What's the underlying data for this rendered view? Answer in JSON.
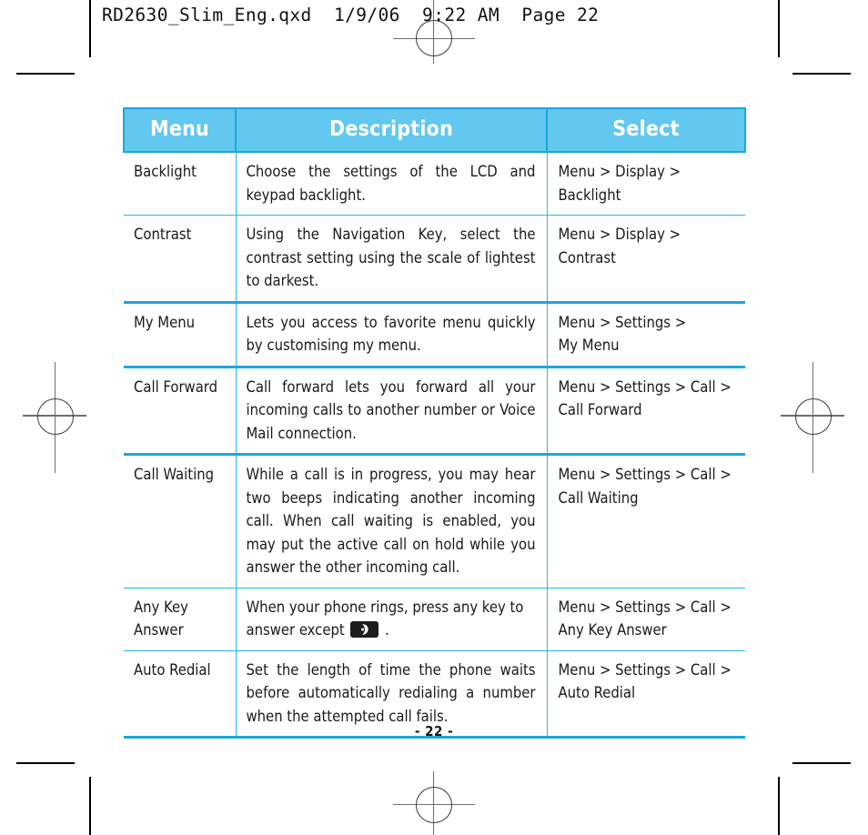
{
  "prepress": {
    "header_line": "RD2630_Slim_Eng.qxd  1/9/06  9:22 AM  Page 22"
  },
  "table": {
    "columns": [
      "Menu",
      "Description",
      "Select"
    ],
    "rows": [
      {
        "menu": "Backlight",
        "description": "Choose the settings of the LCD and keypad backlight.",
        "select": [
          "Menu > Display >",
          "Backlight"
        ]
      },
      {
        "menu": "Contrast",
        "description": "Using the Navigation Key, select the contrast setting using the scale of lightest to darkest.",
        "select": [
          "Menu > Display >",
          "Contrast"
        ]
      },
      {
        "menu": "My Menu",
        "description": "Lets you access to favorite menu quickly by customising  my menu.",
        "select": [
          "Menu > Settings >",
          "My Menu"
        ]
      },
      {
        "menu": "Call Forward",
        "description": "Call forward lets you forward all your incoming calls to another number or Voice Mail connection.",
        "select": [
          "Menu > Settings > Call >",
          "Call Forward"
        ]
      },
      {
        "menu": "Call Waiting",
        "description": "While a call is in progress, you may hear two beeps indicating another incoming call. When call waiting is enabled, you may put the active call on hold while you answer the other incoming call.",
        "select": [
          "Menu > Settings > Call >",
          "Call Waiting"
        ]
      },
      {
        "menu": "Any Key\nAnswer",
        "description_before_icon": "When your phone rings, press any key to answer except",
        "description_after_icon": ".",
        "icon": "end-call-key-icon",
        "select": [
          "Menu > Settings > Call >",
          "Any Key Answer"
        ]
      },
      {
        "menu": "Auto Redial",
        "description": "Set the length of time the phone waits before automatically redialing a number when the attempted call fails.",
        "select": [
          "Menu > Settings > Call >",
          "Auto Redial"
        ]
      }
    ]
  },
  "footer": {
    "page_label": "- 22 -"
  },
  "colors": {
    "header_fill": "#62c8ef",
    "header_text": "#ffffff",
    "rule_thick": "#18a8e0",
    "rule_thin": "#29b6ec",
    "body_text": "#1a1a1a"
  }
}
